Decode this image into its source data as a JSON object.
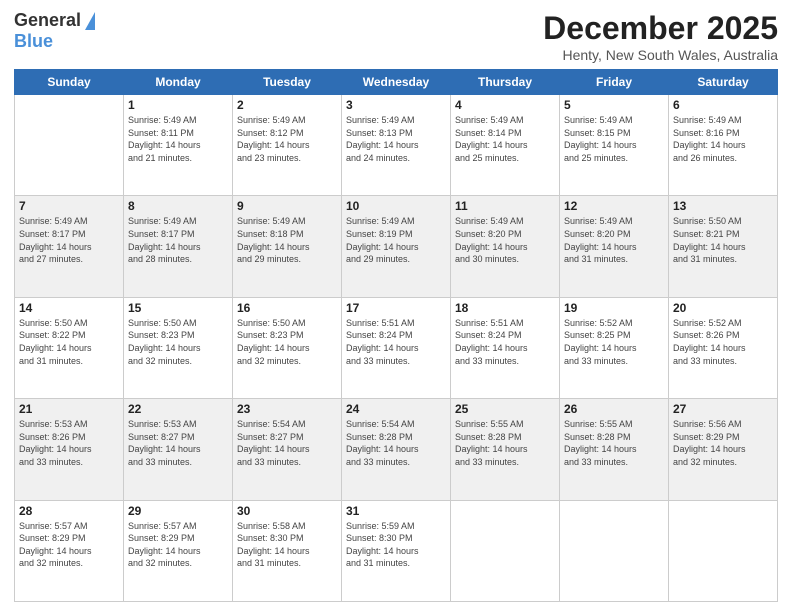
{
  "logo": {
    "general": "General",
    "blue": "Blue"
  },
  "title": "December 2025",
  "location": "Henty, New South Wales, Australia",
  "days_of_week": [
    "Sunday",
    "Monday",
    "Tuesday",
    "Wednesday",
    "Thursday",
    "Friday",
    "Saturday"
  ],
  "weeks": [
    [
      {
        "day": "",
        "info": ""
      },
      {
        "day": "1",
        "info": "Sunrise: 5:49 AM\nSunset: 8:11 PM\nDaylight: 14 hours\nand 21 minutes."
      },
      {
        "day": "2",
        "info": "Sunrise: 5:49 AM\nSunset: 8:12 PM\nDaylight: 14 hours\nand 23 minutes."
      },
      {
        "day": "3",
        "info": "Sunrise: 5:49 AM\nSunset: 8:13 PM\nDaylight: 14 hours\nand 24 minutes."
      },
      {
        "day": "4",
        "info": "Sunrise: 5:49 AM\nSunset: 8:14 PM\nDaylight: 14 hours\nand 25 minutes."
      },
      {
        "day": "5",
        "info": "Sunrise: 5:49 AM\nSunset: 8:15 PM\nDaylight: 14 hours\nand 25 minutes."
      },
      {
        "day": "6",
        "info": "Sunrise: 5:49 AM\nSunset: 8:16 PM\nDaylight: 14 hours\nand 26 minutes."
      }
    ],
    [
      {
        "day": "7",
        "info": "Sunrise: 5:49 AM\nSunset: 8:17 PM\nDaylight: 14 hours\nand 27 minutes."
      },
      {
        "day": "8",
        "info": "Sunrise: 5:49 AM\nSunset: 8:17 PM\nDaylight: 14 hours\nand 28 minutes."
      },
      {
        "day": "9",
        "info": "Sunrise: 5:49 AM\nSunset: 8:18 PM\nDaylight: 14 hours\nand 29 minutes."
      },
      {
        "day": "10",
        "info": "Sunrise: 5:49 AM\nSunset: 8:19 PM\nDaylight: 14 hours\nand 29 minutes."
      },
      {
        "day": "11",
        "info": "Sunrise: 5:49 AM\nSunset: 8:20 PM\nDaylight: 14 hours\nand 30 minutes."
      },
      {
        "day": "12",
        "info": "Sunrise: 5:49 AM\nSunset: 8:20 PM\nDaylight: 14 hours\nand 31 minutes."
      },
      {
        "day": "13",
        "info": "Sunrise: 5:50 AM\nSunset: 8:21 PM\nDaylight: 14 hours\nand 31 minutes."
      }
    ],
    [
      {
        "day": "14",
        "info": "Sunrise: 5:50 AM\nSunset: 8:22 PM\nDaylight: 14 hours\nand 31 minutes."
      },
      {
        "day": "15",
        "info": "Sunrise: 5:50 AM\nSunset: 8:23 PM\nDaylight: 14 hours\nand 32 minutes."
      },
      {
        "day": "16",
        "info": "Sunrise: 5:50 AM\nSunset: 8:23 PM\nDaylight: 14 hours\nand 32 minutes."
      },
      {
        "day": "17",
        "info": "Sunrise: 5:51 AM\nSunset: 8:24 PM\nDaylight: 14 hours\nand 33 minutes."
      },
      {
        "day": "18",
        "info": "Sunrise: 5:51 AM\nSunset: 8:24 PM\nDaylight: 14 hours\nand 33 minutes."
      },
      {
        "day": "19",
        "info": "Sunrise: 5:52 AM\nSunset: 8:25 PM\nDaylight: 14 hours\nand 33 minutes."
      },
      {
        "day": "20",
        "info": "Sunrise: 5:52 AM\nSunset: 8:26 PM\nDaylight: 14 hours\nand 33 minutes."
      }
    ],
    [
      {
        "day": "21",
        "info": "Sunrise: 5:53 AM\nSunset: 8:26 PM\nDaylight: 14 hours\nand 33 minutes."
      },
      {
        "day": "22",
        "info": "Sunrise: 5:53 AM\nSunset: 8:27 PM\nDaylight: 14 hours\nand 33 minutes."
      },
      {
        "day": "23",
        "info": "Sunrise: 5:54 AM\nSunset: 8:27 PM\nDaylight: 14 hours\nand 33 minutes."
      },
      {
        "day": "24",
        "info": "Sunrise: 5:54 AM\nSunset: 8:28 PM\nDaylight: 14 hours\nand 33 minutes."
      },
      {
        "day": "25",
        "info": "Sunrise: 5:55 AM\nSunset: 8:28 PM\nDaylight: 14 hours\nand 33 minutes."
      },
      {
        "day": "26",
        "info": "Sunrise: 5:55 AM\nSunset: 8:28 PM\nDaylight: 14 hours\nand 33 minutes."
      },
      {
        "day": "27",
        "info": "Sunrise: 5:56 AM\nSunset: 8:29 PM\nDaylight: 14 hours\nand 32 minutes."
      }
    ],
    [
      {
        "day": "28",
        "info": "Sunrise: 5:57 AM\nSunset: 8:29 PM\nDaylight: 14 hours\nand 32 minutes."
      },
      {
        "day": "29",
        "info": "Sunrise: 5:57 AM\nSunset: 8:29 PM\nDaylight: 14 hours\nand 32 minutes."
      },
      {
        "day": "30",
        "info": "Sunrise: 5:58 AM\nSunset: 8:30 PM\nDaylight: 14 hours\nand 31 minutes."
      },
      {
        "day": "31",
        "info": "Sunrise: 5:59 AM\nSunset: 8:30 PM\nDaylight: 14 hours\nand 31 minutes."
      },
      {
        "day": "",
        "info": ""
      },
      {
        "day": "",
        "info": ""
      },
      {
        "day": "",
        "info": ""
      }
    ]
  ]
}
